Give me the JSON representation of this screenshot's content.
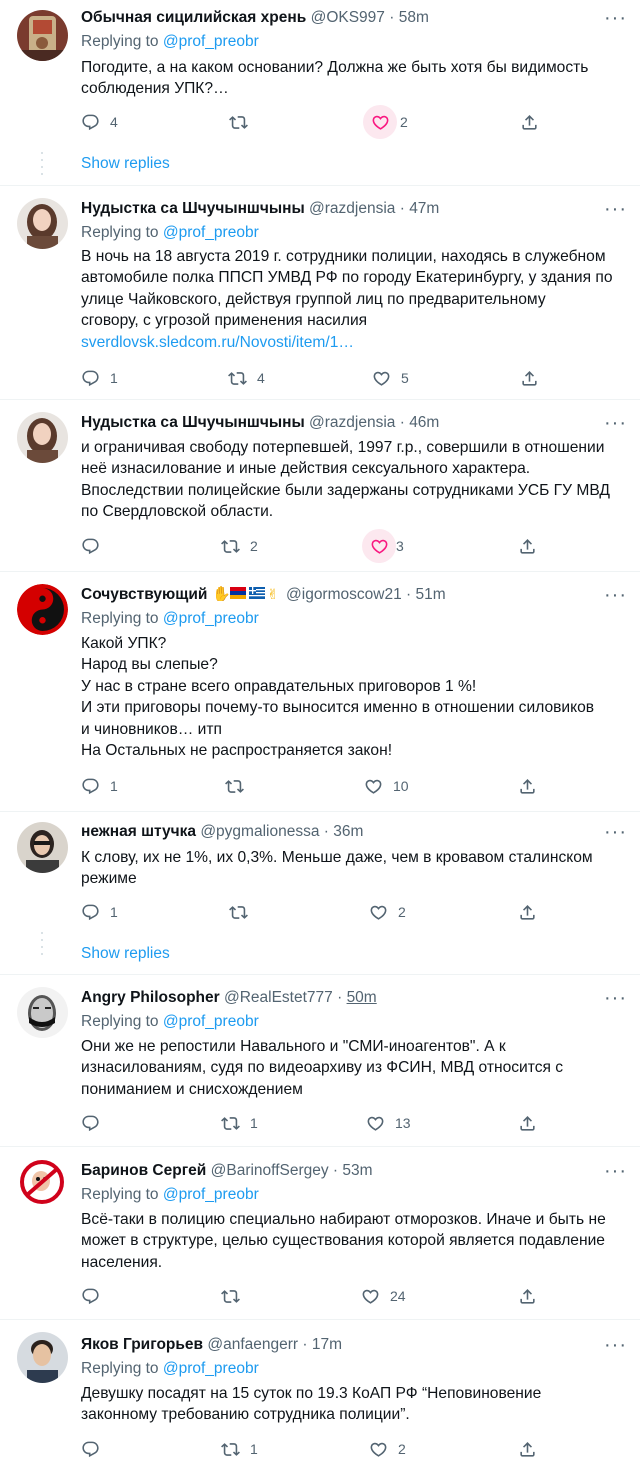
{
  "show_replies_label": "Show replies",
  "replying_prefix": "Replying to ",
  "tweets": [
    {
      "name": "Обычная сицилийская хрень",
      "handle": "@OKS997",
      "dot": "·",
      "time": "58m",
      "reply_to": "@prof_preobr",
      "text": "Погодите, а на каком основании? Должна же быть хотя бы видимость\nсоблюдения УПК?…",
      "replies": "4",
      "retweets": "",
      "likes": "2",
      "liked": true
    },
    {
      "name": "Нудыстка са Шчучыншчыны",
      "handle": "@razdjensia",
      "dot": "·",
      "time": "47m",
      "reply_to": "@prof_preobr",
      "text": "В ночь на 18 августа 2019 г. сотрудники полиции, находясь в служебном\nавтомобиле полка ППСП УМВД РФ по городу Екатеринбургу, у здания по\nулице Чайковского, действуя группой лиц по предварительному\nсговору, с угрозой применения насилия",
      "link": "sverdlovsk.sledcom.ru/Novosti/item/1…",
      "replies": "1",
      "retweets": "4",
      "likes": "5",
      "liked": false
    },
    {
      "name": "Нудыстка са Шчучыншчыны",
      "handle": "@razdjensia",
      "dot": "·",
      "time": "46m",
      "text": "и ограничивая свободу потерпевшей, 1997 г.р., совершили в отношении\nнеё изнасилование и иные действия сексуального характера.\nВпоследствии полицейские были задержаны сотрудниками УСБ ГУ МВД\nпо Свердловской области.",
      "replies": "",
      "retweets": "2",
      "likes": "3",
      "liked": true
    },
    {
      "name": "Сочувствующий",
      "emoji_desc": "raised-hands armenia-flag greece-flag victory-hand",
      "handle": "@igormoscow21",
      "dot": "·",
      "time": "51m",
      "reply_to": "@prof_preobr",
      "text": "Какой УПК?\nНарод вы слепые?\nУ нас в стране всего оправдательных приговоров 1 %!\nИ эти  приговоры почему-то выносится именно в отношении силовиков\nи чиновников… итп\nНа Остальных не распространяется закон!",
      "replies": "1",
      "retweets": "",
      "likes": "10",
      "liked": false
    },
    {
      "name": "нежная штучка",
      "handle": "@pygmalionessa",
      "dot": "·",
      "time": "36m",
      "text": "К слову, их не 1%, их 0,3%. Меньше даже, чем в кровавом сталинском\nрежиме",
      "replies": "1",
      "retweets": "",
      "likes": "2",
      "liked": false
    },
    {
      "name": "Angry Philosopher",
      "handle": "@RealEstet777",
      "dot": "·",
      "time": "50m",
      "reply_to": "@prof_preobr",
      "text": "Они же не репостили Навального и \"СМИ-иноагентов\". А к\nизнасилованиям, судя по видеоархиву из ФСИН, МВД относится с\nпониманием и снисхождением",
      "replies": "",
      "retweets": "1",
      "likes": "13",
      "liked": false
    },
    {
      "name": "Баринов Сергей",
      "handle": "@BarinoffSergey",
      "dot": "·",
      "time": "53m",
      "reply_to": "@prof_preobr",
      "text": "Всё-таки в полицию специально набирают отморозков. Иначе и быть не\nможет в структуре, целью существования которой является подавление\nнаселения.",
      "replies": "",
      "retweets": "",
      "likes": "24",
      "liked": false
    },
    {
      "name": "Яков Григорьев",
      "handle": "@anfaengerr",
      "dot": "·",
      "time": "17m",
      "reply_to": "@prof_preobr",
      "text": "Девушку посадят на 15 суток по 19.3 КоАП РФ “Неповиновение\nзаконному требованию сотрудника полиции”.",
      "replies": "",
      "retweets": "1",
      "likes": "2",
      "liked": false
    }
  ],
  "colors": {
    "accent": "#1d9bf0",
    "like_active": "#f91880",
    "muted": "#536471",
    "divider": "#eff3f4"
  }
}
